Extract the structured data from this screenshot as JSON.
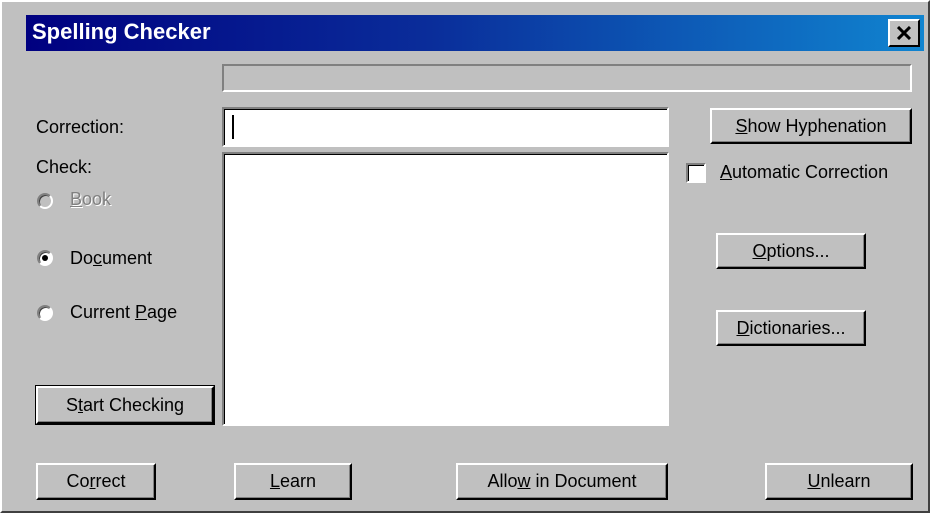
{
  "window": {
    "title": "Spelling Checker"
  },
  "progress": {
    "value": 0
  },
  "correction": {
    "label": "Correction:",
    "value": ""
  },
  "check": {
    "label": "Check:",
    "options": [
      {
        "label": "Book",
        "selected": false,
        "enabled": false
      },
      {
        "label": "Document",
        "selected": true,
        "enabled": true
      },
      {
        "label": "Current Page",
        "selected": false,
        "enabled": true
      }
    ]
  },
  "buttons": {
    "show_hyphenation": "Show Hyphenation",
    "options": "Options...",
    "dictionaries": "Dictionaries...",
    "start_checking": "Start Checking",
    "correct": "Correct",
    "learn": "Learn",
    "allow_in_document": "Allow in Document",
    "unlearn": "Unlearn"
  },
  "auto_correction": {
    "label": "Automatic Correction",
    "checked": false
  },
  "suggestions": []
}
